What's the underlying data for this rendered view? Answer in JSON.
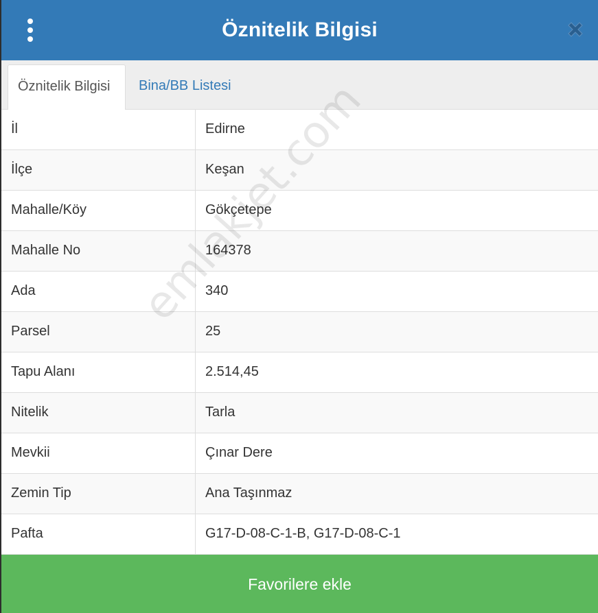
{
  "header": {
    "title": "Öznitelik Bilgisi",
    "menu_icon": "vertical-dots-icon",
    "close_icon": "close-icon"
  },
  "tabs": [
    {
      "label": "Öznitelik Bilgisi",
      "active": true
    },
    {
      "label": "Bina/BB Listesi",
      "active": false
    }
  ],
  "rows": [
    {
      "label": "İl",
      "value": "Edirne"
    },
    {
      "label": "İlçe",
      "value": "Keşan"
    },
    {
      "label": "Mahalle/Köy",
      "value": "Gökçetepe"
    },
    {
      "label": "Mahalle No",
      "value": "164378"
    },
    {
      "label": "Ada",
      "value": "340"
    },
    {
      "label": "Parsel",
      "value": "25"
    },
    {
      "label": "Tapu Alanı",
      "value": "2.514,45"
    },
    {
      "label": "Nitelik",
      "value": "Tarla"
    },
    {
      "label": "Mevkii",
      "value": "Çınar Dere"
    },
    {
      "label": "Zemin Tip",
      "value": "Ana Taşınmaz"
    },
    {
      "label": "Pafta",
      "value": "G17-D-08-C-1-B, G17-D-08-C-1"
    }
  ],
  "watermark": "emlakjet.com",
  "footer": {
    "favorite_label": "Favorilere ekle"
  },
  "colors": {
    "header_bg": "#337ab7",
    "tab_link": "#337ab7",
    "button_bg": "#5cb85c",
    "close_icon": "#2a5f8f"
  }
}
